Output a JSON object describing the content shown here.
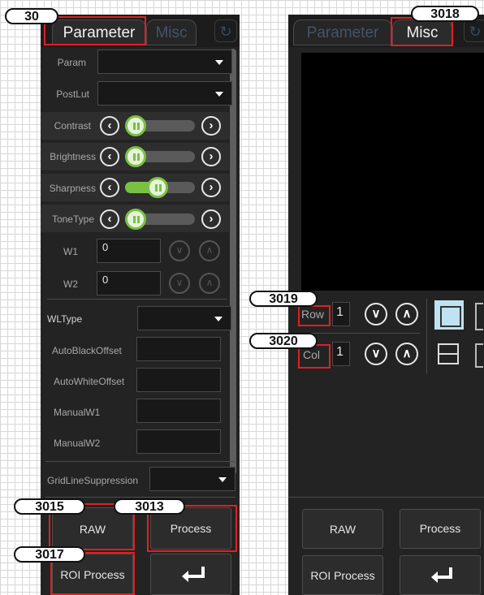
{
  "left_panel": {
    "tabs": [
      {
        "label": "Parameter",
        "active": true
      },
      {
        "label": "Misc",
        "active": false
      }
    ],
    "refresh_icon": "refresh-icon",
    "param_label": "Param",
    "postlut_label": "PostLut",
    "sliders": [
      {
        "label": "Contrast",
        "value": 0.0
      },
      {
        "label": "Brightness",
        "value": 0.0
      },
      {
        "label": "Sharpness",
        "value": 0.45
      },
      {
        "label": "ToneType",
        "value": 0.0
      }
    ],
    "w1": {
      "label": "W1",
      "value": "0"
    },
    "w2": {
      "label": "W2",
      "value": "0"
    },
    "wltype_label": "WLType",
    "auto_black_label": "AutoBlackOffset",
    "auto_white_label": "AutoWhiteOffset",
    "manual_w1_label": "ManualW1",
    "manual_w2_label": "ManualW2",
    "gridline_label": "GridLineSuppression",
    "buttons": {
      "raw": "RAW",
      "process": "Process",
      "roi_process": "ROI Process",
      "enter_icon": "enter-arrow-icon"
    }
  },
  "right_panel": {
    "tabs": [
      {
        "label": "Parameter",
        "active": false
      },
      {
        "label": "Misc",
        "active": true
      }
    ],
    "row": {
      "label": "Row",
      "value": "1"
    },
    "col": {
      "label": "Col",
      "value": "1"
    },
    "buttons": {
      "raw": "RAW",
      "process": "Process",
      "roi_process": "ROI Process",
      "enter_icon": "enter-arrow-icon"
    }
  },
  "callouts": {
    "c30": "30",
    "c3018": "3018",
    "c3019": "3019",
    "c3020": "3020",
    "c3015": "3015",
    "c3013": "3013",
    "c3017": "3017"
  },
  "colors": {
    "panel_bg": "#232323",
    "accent_green": "#7ac143",
    "highlight_blue": "#bfe3f2",
    "callout_red": "#e02020"
  }
}
